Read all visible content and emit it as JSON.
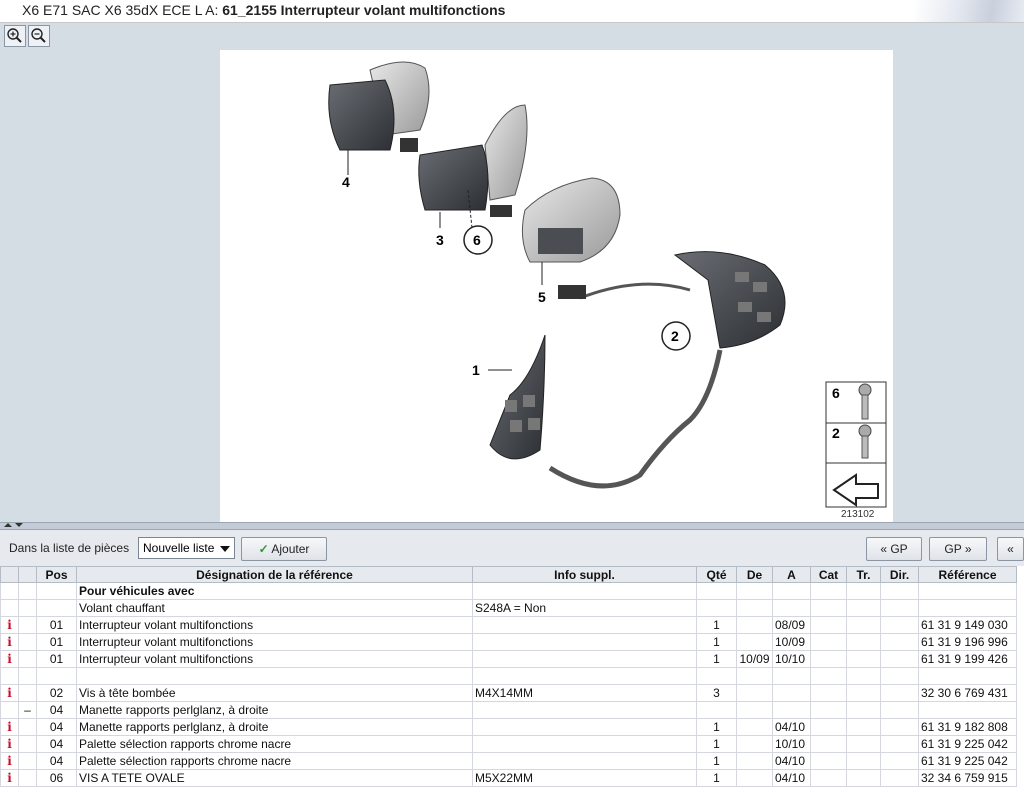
{
  "title": {
    "prefix": "X6 E71 SAC X6 35dX ECE  L A: ",
    "main": "61_2155 Interrupteur volant multifonctions"
  },
  "zoom": {
    "in_icon": "zoom-in-icon",
    "out_icon": "zoom-out-icon"
  },
  "diagram": {
    "callouts": [
      "4",
      "3",
      "6",
      "5",
      "2",
      "1"
    ],
    "legend": [
      "6",
      "2"
    ],
    "image_number": "213102"
  },
  "toolbar": {
    "list_label": "Dans la liste de pièces",
    "list_select": "Nouvelle liste",
    "add_label": "Ajouter",
    "gp_prev": "GP",
    "gp_next": "GP",
    "more": "«"
  },
  "table": {
    "headers": [
      "",
      "",
      "Pos",
      "Désignation de la référence",
      "Info suppl.",
      "Qté",
      "De",
      "A",
      "Cat",
      "Tr.",
      "Dir.",
      "Référence"
    ],
    "rows": [
      {
        "info": "",
        "mark": "",
        "pos": "",
        "designation": "Pour véhicules avec",
        "info_suppl": "",
        "qte": "",
        "de": "",
        "a": "",
        "cat": "",
        "tr": "",
        "dir": "",
        "ref": "",
        "group": true
      },
      {
        "info": "",
        "mark": "",
        "pos": "",
        "designation": "Volant chauffant",
        "info_suppl": "S248A = Non",
        "qte": "",
        "de": "",
        "a": "",
        "cat": "",
        "tr": "",
        "dir": "",
        "ref": ""
      },
      {
        "info": "i",
        "mark": "",
        "pos": "01",
        "designation": "Interrupteur volant multifonctions",
        "info_suppl": "",
        "qte": "1",
        "de": "",
        "a": "08/09",
        "cat": "",
        "tr": "",
        "dir": "",
        "ref": "61 31 9 149 030"
      },
      {
        "info": "i",
        "mark": "",
        "pos": "01",
        "designation": "Interrupteur volant multifonctions",
        "info_suppl": "",
        "qte": "1",
        "de": "",
        "a": "10/09",
        "cat": "",
        "tr": "",
        "dir": "",
        "ref": "61 31 9 196 996"
      },
      {
        "info": "i",
        "mark": "",
        "pos": "01",
        "designation": "Interrupteur volant multifonctions",
        "info_suppl": "",
        "qte": "1",
        "de": "10/09",
        "a": "10/10",
        "cat": "",
        "tr": "",
        "dir": "",
        "ref": "61 31 9 199 426"
      },
      {
        "info": "",
        "mark": "",
        "pos": "",
        "designation": "",
        "info_suppl": "",
        "qte": "",
        "de": "",
        "a": "",
        "cat": "",
        "tr": "",
        "dir": "",
        "ref": ""
      },
      {
        "info": "i",
        "mark": "",
        "pos": "02",
        "designation": "Vis à tête bombée",
        "info_suppl": "M4X14MM",
        "qte": "3",
        "de": "",
        "a": "",
        "cat": "",
        "tr": "",
        "dir": "",
        "ref": "32 30 6 769 431"
      },
      {
        "info": "",
        "mark": "–",
        "pos": "04",
        "designation": "Manette rapports perlglanz, à droite",
        "info_suppl": "",
        "qte": "",
        "de": "",
        "a": "",
        "cat": "",
        "tr": "",
        "dir": "",
        "ref": ""
      },
      {
        "info": "i",
        "mark": "",
        "pos": "04",
        "designation": "Manette rapports perlglanz, à droite",
        "info_suppl": "",
        "qte": "1",
        "de": "",
        "a": "04/10",
        "cat": "",
        "tr": "",
        "dir": "",
        "ref": "61 31 9 182 808"
      },
      {
        "info": "i",
        "mark": "",
        "pos": "04",
        "designation": "Palette sélection rapports chrome nacre",
        "info_suppl": "",
        "qte": "1",
        "de": "",
        "a": "10/10",
        "cat": "",
        "tr": "",
        "dir": "",
        "ref": "61 31 9 225 042"
      },
      {
        "info": "i",
        "mark": "",
        "pos": "04",
        "designation": "Palette sélection rapports chrome nacre",
        "info_suppl": "",
        "qte": "1",
        "de": "",
        "a": "04/10",
        "cat": "",
        "tr": "",
        "dir": "",
        "ref": "61 31 9 225 042"
      },
      {
        "info": "i",
        "mark": "",
        "pos": "06",
        "designation": "VIS A TETE OVALE",
        "info_suppl": "M5X22MM",
        "qte": "1",
        "de": "",
        "a": "04/10",
        "cat": "",
        "tr": "",
        "dir": "",
        "ref": "32 34 6 759 915"
      }
    ]
  },
  "colors": {
    "background": "#d4dce4",
    "info_icon": "#c8102e",
    "check": "#2e9a2e"
  }
}
